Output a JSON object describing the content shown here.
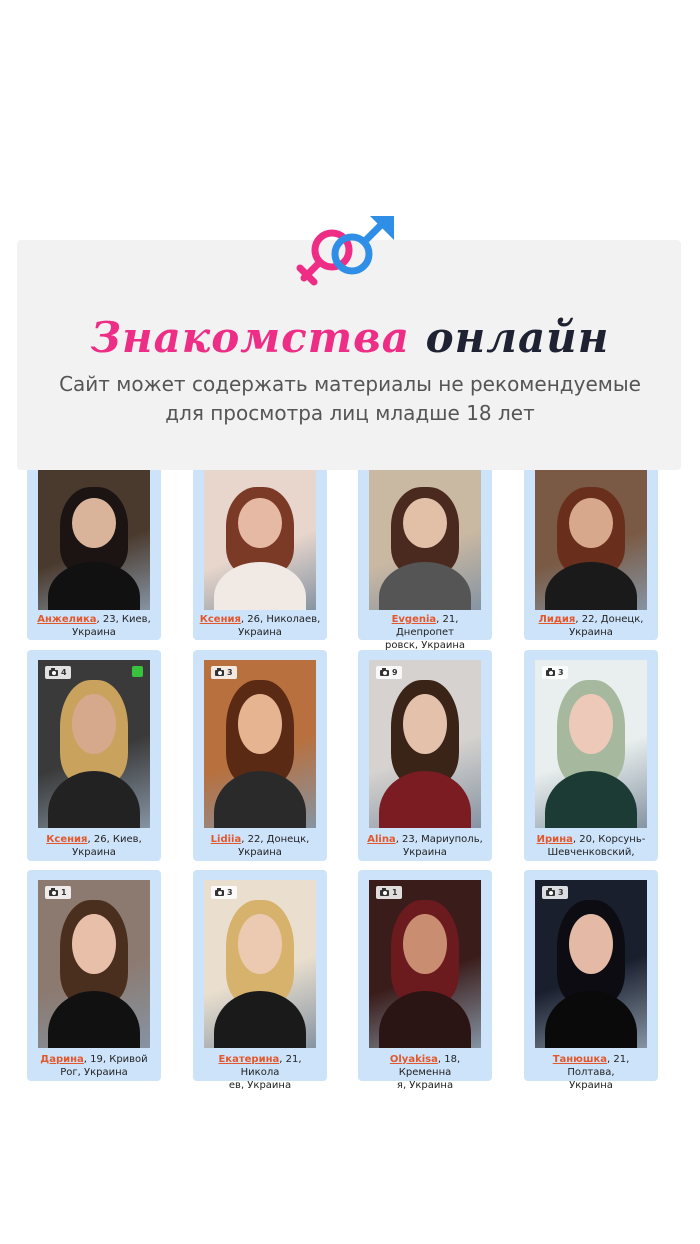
{
  "banner": {
    "title_pink": "Знакомства",
    "title_dark": "онлайн",
    "warning_line1": "Сайт может содержать материалы не рекомендуемые",
    "warning_line2": "для просмотра лиц младше 18 лет",
    "colors": {
      "pink": "#ee2e86",
      "blue": "#2f8fe6",
      "dark": "#1e2233",
      "panel": "#f2f2f2"
    },
    "logo_icon": "gender-symbols-icon"
  },
  "theme": {
    "card_bg": "#cde3fa",
    "link": "#e2572b"
  },
  "profiles": [
    {
      "name": "Анжелика",
      "details_line1": ", 23, Киев,",
      "details_line2": "Украина",
      "photos": null,
      "online": false,
      "bg": "#4a3a2e",
      "skin": "#d9b49b",
      "hair": "#1b1412",
      "clothes": "#111111"
    },
    {
      "name": "Ксения",
      "details_line1": ", 26, Николаев,",
      "details_line2": "Украина",
      "photos": null,
      "online": false,
      "bg": "#e8d6cc",
      "skin": "#e6b9a4",
      "hair": "#7a3a26",
      "clothes": "#f1e9e4"
    },
    {
      "name": "Evgenia",
      "details_line1": ", 21, Днепропет",
      "details_line2": "ровск, Украина",
      "photos": null,
      "online": false,
      "bg": "#c9b8a2",
      "skin": "#e2c0a8",
      "hair": "#4a2a1e",
      "clothes": "#555555"
    },
    {
      "name": "Лидия",
      "details_line1": ", 22, Донецк,",
      "details_line2": "Украина",
      "photos": null,
      "online": false,
      "bg": "#7a5a44",
      "skin": "#d8a88c",
      "hair": "#6a2f1c",
      "clothes": "#1a1a1a"
    },
    {
      "name": "Ксения",
      "details_line1": ", 26, Киев,",
      "details_line2": "Украина",
      "photos": "4",
      "online": true,
      "bg": "#3a3a3a",
      "skin": "#d7a98c",
      "hair": "#c9a25e",
      "clothes": "#222222"
    },
    {
      "name": "Lidiia",
      "details_line1": ", 22, Донецк,",
      "details_line2": "Украина",
      "photos": "3",
      "online": false,
      "bg": "#b8703e",
      "skin": "#e7b491",
      "hair": "#5a2a14",
      "clothes": "#2a2a2a"
    },
    {
      "name": "Alina",
      "details_line1": ", 23, Мариуполь,",
      "details_line2": "Украина",
      "photos": "9",
      "online": false,
      "bg": "#d5d2cf",
      "skin": "#e3c1ab",
      "hair": "#3a2418",
      "clothes": "#7a1c22"
    },
    {
      "name": "Ирина",
      "details_line1": ", 20, Корсунь-",
      "details_line2": "Шевченковский,",
      "photos": "3",
      "online": false,
      "bg": "#e9efee",
      "skin": "#edc9b9",
      "hair": "#a6b99e",
      "clothes": "#1b3b34"
    },
    {
      "name": "Дарина",
      "details_line1": ", 19, Кривой",
      "details_line2": "Рог, Украина",
      "photos": "1",
      "online": false,
      "bg": "#8c7a70",
      "skin": "#e8c0aa",
      "hair": "#4a2e1e",
      "clothes": "#111111"
    },
    {
      "name": "Екатерина",
      "details_line1": ", 21, Никола",
      "details_line2": "ев, Украина",
      "photos": "3",
      "online": false,
      "bg": "#eadfce",
      "skin": "#eccab2",
      "hair": "#d7b26c",
      "clothes": "#1a1a1a"
    },
    {
      "name": "Olyakisa",
      "details_line1": ", 18, Кременна",
      "details_line2": "я, Украина",
      "photos": "1",
      "online": false,
      "bg": "#3a1c1a",
      "skin": "#c98d72",
      "hair": "#6b1a1e",
      "clothes": "#2a1414"
    },
    {
      "name": "Танюшка",
      "details_line1": ", 21, Полтава,",
      "details_line2": "Украина",
      "photos": "3",
      "online": false,
      "bg": "#1a1f2e",
      "skin": "#e4b9a5",
      "hair": "#0c0c12",
      "clothes": "#0a0a0a"
    }
  ]
}
